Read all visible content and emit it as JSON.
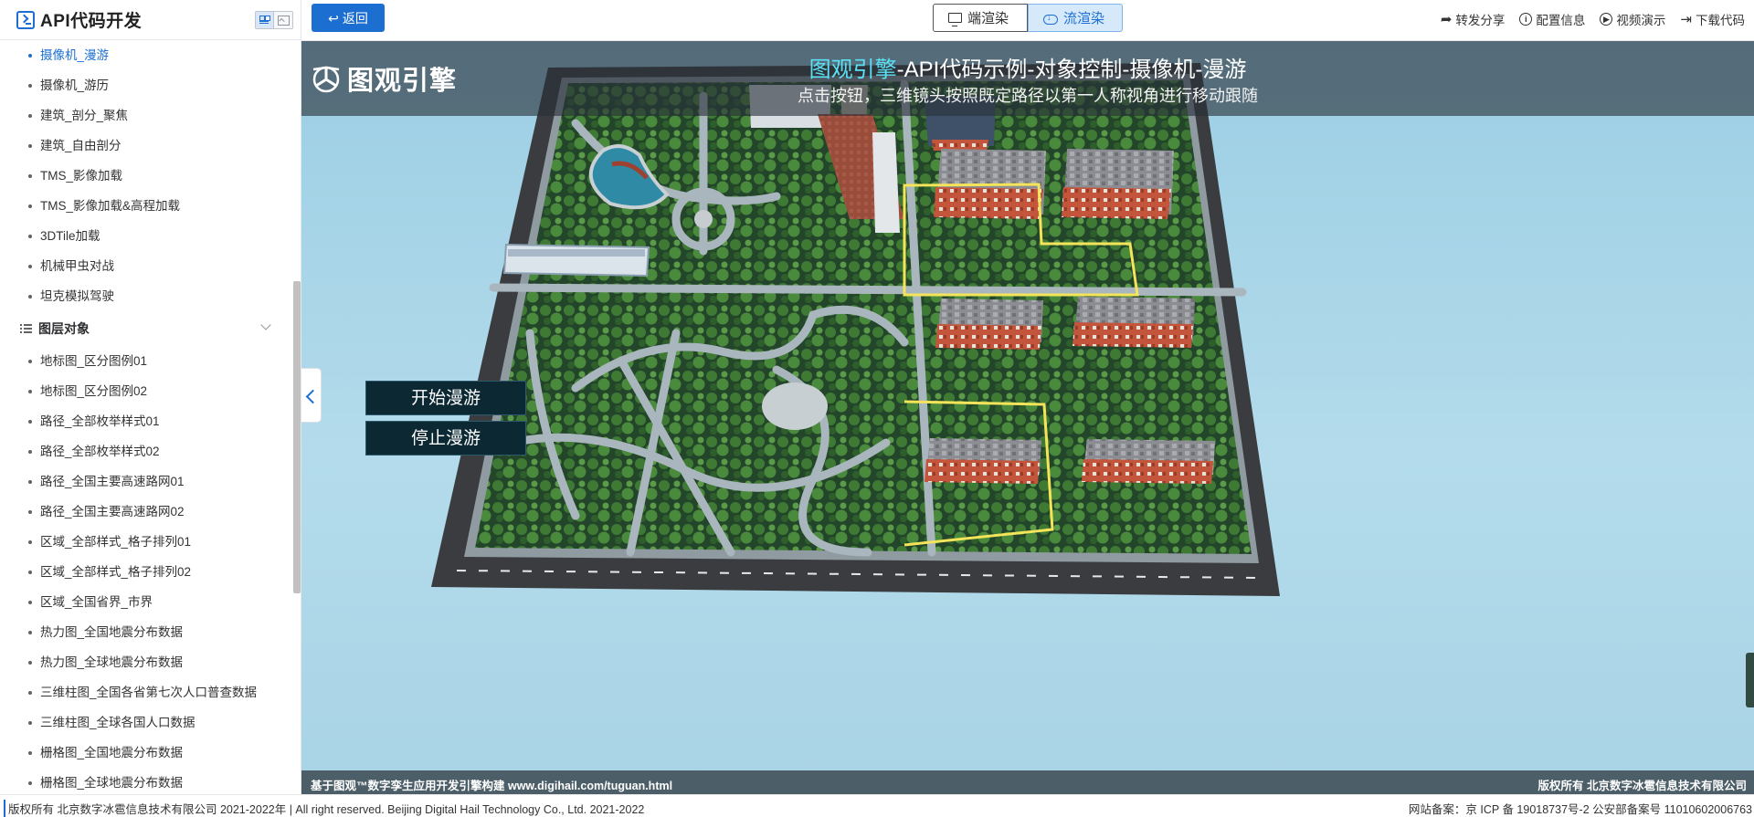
{
  "sidebar": {
    "title": "API代码开发",
    "items_top": [
      {
        "label": "摄像机_漫游",
        "active": true
      },
      {
        "label": "摄像机_游历"
      },
      {
        "label": "建筑_剖分_聚焦"
      },
      {
        "label": "建筑_自由剖分"
      },
      {
        "label": "TMS_影像加载"
      },
      {
        "label": "TMS_影像加载&高程加载"
      },
      {
        "label": "3DTile加载"
      },
      {
        "label": "机械甲虫对战"
      },
      {
        "label": "坦克模拟驾驶"
      }
    ],
    "group_label": "图层对象",
    "items_group": [
      {
        "label": "地标图_区分图例01"
      },
      {
        "label": "地标图_区分图例02"
      },
      {
        "label": "路径_全部枚举样式01"
      },
      {
        "label": "路径_全部枚举样式02"
      },
      {
        "label": "路径_全国主要高速路网01"
      },
      {
        "label": "路径_全国主要高速路网02"
      },
      {
        "label": "区域_全部样式_格子排列01"
      },
      {
        "label": "区域_全部样式_格子排列02"
      },
      {
        "label": "区域_全国省界_市界"
      },
      {
        "label": "热力图_全国地震分布数据"
      },
      {
        "label": "热力图_全球地震分布数据"
      },
      {
        "label": "三维柱图_全国各省第七次人口普查数据"
      },
      {
        "label": "三维柱图_全球各国人口数据"
      },
      {
        "label": "栅格图_全国地震分布数据"
      },
      {
        "label": "栅格图_全球地震分布数据"
      }
    ]
  },
  "toolbar": {
    "back_label": "返回",
    "render_client_label": "端渲染",
    "render_stream_label": "流渲染",
    "share_label": "转发分享",
    "config_label": "配置信息",
    "video_label": "视频演示",
    "download_label": "下载代码"
  },
  "viewport": {
    "brand": "图观引擎",
    "title_accent": "图观引擎",
    "title_rest": "-API代码示例-对象控制-摄像机-漫游",
    "subtitle": "点击按钮，三维镜头按照既定路径以第一人称视角进行移动跟随",
    "start_tour": "开始漫游",
    "stop_tour": "停止漫游",
    "bottom_left": "基于图观™数字孪生应用开发引擎构建 www.digihail.com/tuguan.html",
    "bottom_right": "版权所有 北京数字冰雹信息技术有限公司"
  },
  "footer": {
    "left": "版权所有 北京数字冰雹信息技术有限公司 2021-2022年 | All right reserved. Beijing Digital Hail Technology Co., Ltd. 2021-2022",
    "right": "网站备案：京 ICP 备 19018737号-2 公安部备案号 11010602006763"
  },
  "colors": {
    "primary": "#1c6fd1",
    "title_accent": "#5be1f5",
    "tour_button_bg": "#0b2833",
    "hud_bar": "#283038",
    "boundary_line": "#f3e45a"
  },
  "icons": [
    "terminal-logo-icon",
    "grid-view-icon",
    "image-view-icon",
    "list-icon",
    "chevron-down-icon",
    "back-arrow-icon",
    "monitor-icon",
    "cloud-download-icon",
    "share-icon",
    "info-icon",
    "play-circle-icon",
    "download-icon",
    "tri-logo-icon",
    "chevron-left-icon"
  ]
}
